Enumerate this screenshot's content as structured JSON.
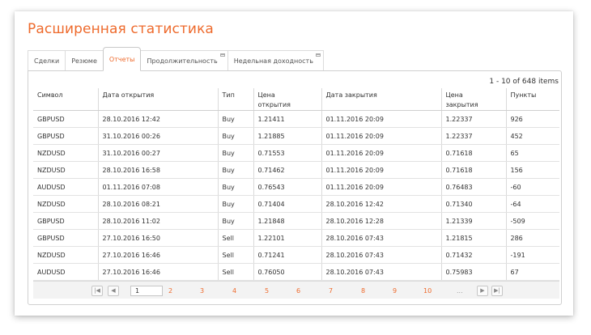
{
  "page": {
    "title": "Расширенная статистика"
  },
  "tabs": [
    {
      "label": "Сделки",
      "active": false,
      "popout": false
    },
    {
      "label": "Резюме",
      "active": false,
      "popout": false
    },
    {
      "label": "Отчеты",
      "active": true,
      "popout": false
    },
    {
      "label": "Продолжительность",
      "active": false,
      "popout": true
    },
    {
      "label": "Недельная доходность",
      "active": false,
      "popout": true
    }
  ],
  "grid": {
    "items_info": "1 - 10 of 648 items",
    "columns": [
      {
        "line1": "Символ",
        "line2": ""
      },
      {
        "line1": "Дата открытия",
        "line2": ""
      },
      {
        "line1": "Тип",
        "line2": ""
      },
      {
        "line1": "Цена",
        "line2": "открытия"
      },
      {
        "line1": "Дата закрытия",
        "line2": ""
      },
      {
        "line1": "Цена",
        "line2": "закрытия"
      },
      {
        "line1": "Пункты",
        "line2": ""
      }
    ],
    "rows": [
      [
        "GBPUSD",
        "28.10.2016 12:42",
        "Buy",
        "1.21411",
        "01.11.2016 20:09",
        "1.22337",
        "926"
      ],
      [
        "GBPUSD",
        "31.10.2016 00:26",
        "Buy",
        "1.21885",
        "01.11.2016 20:09",
        "1.22337",
        "452"
      ],
      [
        "NZDUSD",
        "31.10.2016 00:27",
        "Buy",
        "0.71553",
        "01.11.2016 20:09",
        "0.71618",
        "65"
      ],
      [
        "NZDUSD",
        "28.10.2016 16:58",
        "Buy",
        "0.71462",
        "01.11.2016 20:09",
        "0.71618",
        "156"
      ],
      [
        "AUDUSD",
        "01.11.2016 07:08",
        "Buy",
        "0.76543",
        "01.11.2016 20:09",
        "0.76483",
        "-60"
      ],
      [
        "NZDUSD",
        "28.10.2016 08:21",
        "Buy",
        "0.71404",
        "28.10.2016 12:42",
        "0.71340",
        "-64"
      ],
      [
        "GBPUSD",
        "28.10.2016 11:02",
        "Buy",
        "1.21848",
        "28.10.2016 12:28",
        "1.21339",
        "-509"
      ],
      [
        "GBPUSD",
        "27.10.2016 16:50",
        "Sell",
        "1.22101",
        "28.10.2016 07:43",
        "1.21815",
        "286"
      ],
      [
        "NZDUSD",
        "27.10.2016 16:46",
        "Sell",
        "0.71241",
        "28.10.2016 07:43",
        "0.71432",
        "-191"
      ],
      [
        "AUDUSD",
        "27.10.2016 16:46",
        "Sell",
        "0.76050",
        "28.10.2016 07:43",
        "0.75983",
        "67"
      ]
    ]
  },
  "pager": {
    "current_page": "1",
    "pages": [
      "2",
      "3",
      "4",
      "5",
      "6",
      "7",
      "8",
      "9",
      "10"
    ],
    "ellipsis": "...",
    "first_icon": "first-page-icon",
    "prev_icon": "prev-page-icon",
    "next_icon": "next-page-icon",
    "last_icon": "last-page-icon"
  },
  "colors": {
    "accent": "#ee6a2c",
    "border": "#d0d0d0",
    "pager_bg": "#f3f3f3"
  }
}
